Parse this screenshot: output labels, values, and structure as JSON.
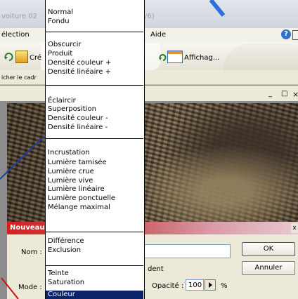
{
  "window": {
    "title_fragment_left": "voiture 02",
    "title_fragment_right": "/6)"
  },
  "menubar": {
    "item_left": "élection",
    "item_aide": "Aide"
  },
  "toolbar": {
    "btn_left": "Cré",
    "btn_affichage": "Affichag..."
  },
  "subbar": {
    "text": "icher le cadr"
  },
  "window_controls": {
    "minimize": "_",
    "restore": "□",
    "close": "×"
  },
  "dialog": {
    "title": "Nouveau",
    "name_label": "Nom :",
    "mode_label": "Mode :",
    "ok_label": "OK",
    "cancel_label": "Annuler",
    "fragment_text": "dent",
    "opacity_label": "Opacité :",
    "opacity_value": "100",
    "opacity_unit": "%",
    "close_glyph": "x"
  },
  "blend_menu": {
    "groups": [
      [
        "Normal",
        "Fondu"
      ],
      [
        "Obscurcir",
        "Produit",
        "Densité couleur +",
        "Densité linéaire +"
      ],
      [
        "Éclaircir",
        "Superposition",
        "Densité couleur -",
        "Densité linéaire -"
      ],
      [
        "Incrustation",
        "Lumière tamisée",
        "Lumière crue",
        "Lumière vive",
        "Lumière linéaire",
        "Lumière ponctuelle",
        "Mélange maximal"
      ],
      [
        "Différence",
        "Exclusion"
      ],
      [
        "Teinte",
        "Saturation",
        "Couleur"
      ]
    ],
    "selected": "Couleur"
  },
  "colors": {
    "selection": "#0a246a",
    "dialog_title_start": "#d62020",
    "background_stripes": "#1e5fd0"
  }
}
